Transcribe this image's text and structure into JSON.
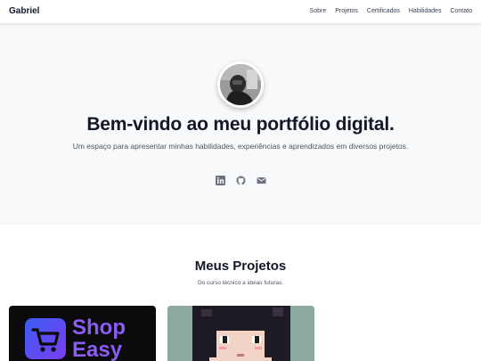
{
  "nav": {
    "brand": "Gabriel",
    "links": [
      "Sobre",
      "Projetos",
      "Certificados",
      "Habilidades",
      "Contato"
    ]
  },
  "hero": {
    "title": "Bem-vindo ao meu portfólio digital.",
    "subtitle": "Um espaço para apresentar minhas habilidades, experiências e aprendizados em diversos projetos.",
    "social_icons": [
      "linkedin-icon",
      "github-icon",
      "mail-icon"
    ]
  },
  "projects": {
    "title": "Meus Projetos",
    "subtitle": "Do curso técnico a ideias futuras.",
    "cards": [
      {
        "image_text": "Shop Easy",
        "icon": "shopping-cart-icon"
      },
      {
        "image_text": ""
      }
    ]
  },
  "colors": {
    "accent": "#8b5cf6",
    "hero_bg": "#f8f9fb",
    "text": "#111827"
  }
}
